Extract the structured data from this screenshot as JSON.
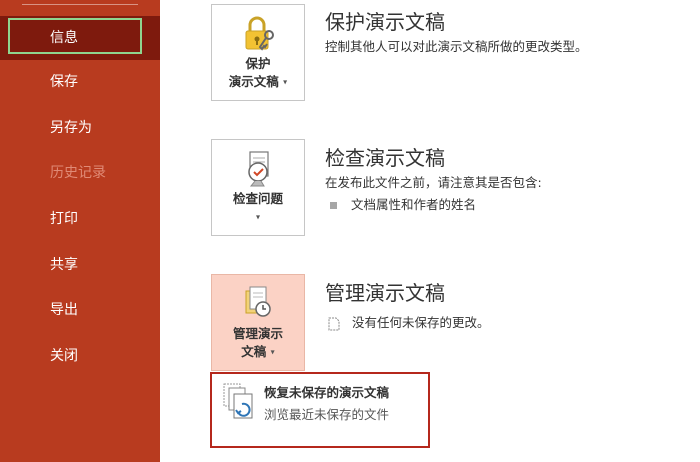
{
  "sidebar": {
    "items": [
      {
        "label": "信息",
        "active": true
      },
      {
        "label": "保存"
      },
      {
        "label": "另存为"
      },
      {
        "label": "历史记录",
        "disabled": true
      },
      {
        "label": "打印"
      },
      {
        "label": "共享"
      },
      {
        "label": "导出"
      },
      {
        "label": "关闭"
      }
    ]
  },
  "protect": {
    "tile_line1": "保护",
    "tile_line2": "演示文稿",
    "title": "保护演示文稿",
    "desc": "控制其他人可以对此演示文稿所做的更改类型。"
  },
  "inspect": {
    "tile_line1": "检查问题",
    "title": "检查演示文稿",
    "desc": "在发布此文件之前，请注意其是否包含:",
    "bullets": [
      "文档属性和作者的姓名"
    ]
  },
  "manage": {
    "tile_line1": "管理演示",
    "tile_line2": "文稿",
    "title": "管理演示文稿",
    "desc": "没有任何未保存的更改。"
  },
  "popup": {
    "title": "恢复未保存的演示文稿",
    "desc": "浏览最近未保存的文件"
  },
  "colors": {
    "sidebar": "#b83b1f",
    "active_item": "#7e1a0d",
    "active_frame": "#8fd48f",
    "highlight_tile": "#fbd2c5",
    "popup_border": "#b5281c"
  },
  "icons": [
    "lock-key-icon",
    "inspect-document-icon",
    "manage-documents-icon",
    "recover-document-icon",
    "document-small-icon"
  ]
}
